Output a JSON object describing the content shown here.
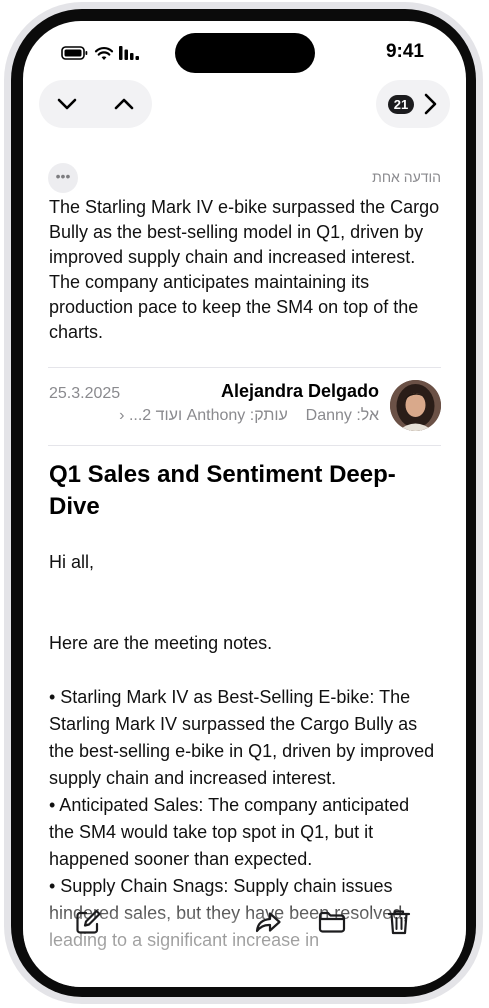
{
  "status_bar": {
    "time": "9:41"
  },
  "nav": {
    "message_count": "21"
  },
  "thread": {
    "count_label": "הודעה אחת"
  },
  "summary": "The Starling Mark IV e-bike surpassed the Cargo Bully as the best-selling model in Q1, driven by improved supply chain and increased interest. The company anticipates maintaining its production pace to keep the SM4 on top of the charts.",
  "message": {
    "date": "25.3.2025",
    "sender": "Alejandra Delgado",
    "to_label": "אל:",
    "to_name": "Danny",
    "cc_label": "עותק:",
    "cc_name": "Anthony",
    "more": "ועוד 2...",
    "subject": "Q1 Sales and Sentiment Deep-Dive",
    "greeting": "Hi all,",
    "intro": "Here are the meeting notes.",
    "bullet1": "• Starling Mark IV as Best-Selling E-bike: The Starling Mark IV surpassed the Cargo Bully as the best-selling e-bike in Q1, driven by improved supply chain and increased interest.",
    "bullet2": "• Anticipated Sales: The company anticipated the SM4 would take top spot in Q1, but it happened sooner than expected.",
    "bullet3": "• Supply Chain Snags: Supply chain issues hindered sales, but they have been resolved, leading to a significant increase in"
  }
}
